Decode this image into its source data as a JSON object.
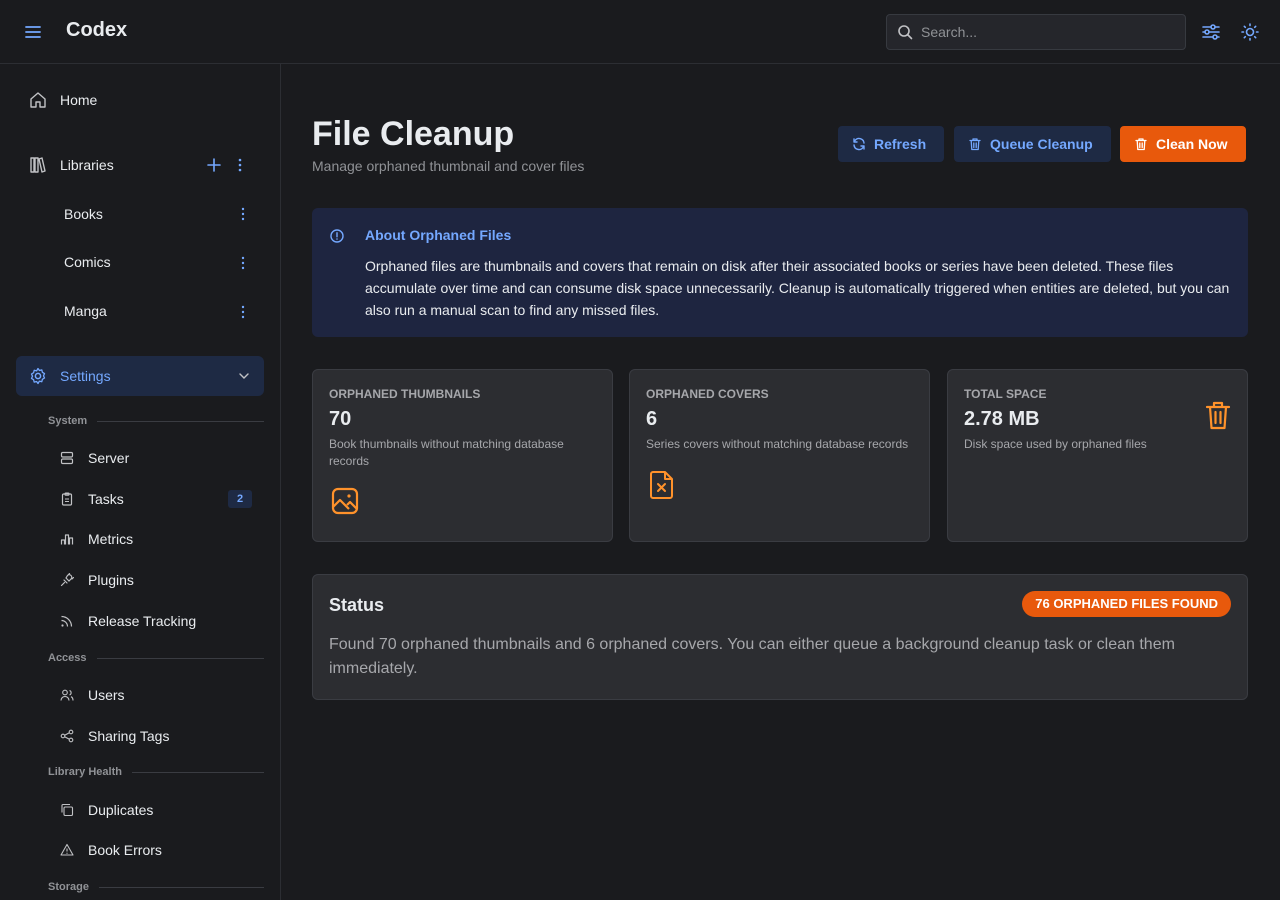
{
  "app": {
    "title": "Codex"
  },
  "header": {
    "search_placeholder": "Search...",
    "search_value": ""
  },
  "sidebar": {
    "home": "Home",
    "libraries": "Libraries",
    "library_items": [
      "Books",
      "Comics",
      "Manga"
    ],
    "settings": "Settings",
    "sections": {
      "system": "System",
      "access": "Access",
      "library_health": "Library Health",
      "storage": "Storage"
    },
    "system_items": {
      "server": "Server",
      "tasks": "Tasks",
      "tasks_badge": "2",
      "metrics": "Metrics",
      "plugins": "Plugins",
      "release_tracking": "Release Tracking"
    },
    "access_items": {
      "users": "Users",
      "sharing_tags": "Sharing Tags"
    },
    "health_items": {
      "duplicates": "Duplicates",
      "book_errors": "Book Errors"
    }
  },
  "page": {
    "title": "File Cleanup",
    "subtitle": "Manage orphaned thumbnail and cover files",
    "buttons": {
      "refresh": "Refresh",
      "queue_cleanup": "Queue Cleanup",
      "clean_now": "Clean Now"
    }
  },
  "alert": {
    "title": "About Orphaned Files",
    "body": "Orphaned files are thumbnails and covers that remain on disk after their associated books or series have been deleted. These files accumulate over time and can consume disk space unnecessarily. Cleanup is automatically triggered when entities are deleted, but you can also run a manual scan to find any missed files."
  },
  "stats": {
    "thumbnails": {
      "label": "ORPHANED THUMBNAILS",
      "value": "70",
      "desc": "Book thumbnails without matching database records",
      "icon": "image-icon"
    },
    "covers": {
      "label": "ORPHANED COVERS",
      "value": "6",
      "desc": "Series covers without matching database records",
      "icon": "file-x-icon"
    },
    "space": {
      "label": "TOTAL SPACE",
      "value": "2.78 MB",
      "desc": "Disk space used by orphaned files",
      "icon": "trash-icon"
    }
  },
  "status": {
    "title": "Status",
    "badge": "76 ORPHANED FILES FOUND",
    "text": "Found 70 orphaned thumbnails and 6 orphaned covers. You can either queue a background cleanup task or clean them immediately."
  },
  "colors": {
    "accent": "#74a8ff",
    "orange": "#e8590c",
    "icon_orange": "#ff922b",
    "background": "#1a1b1e"
  }
}
